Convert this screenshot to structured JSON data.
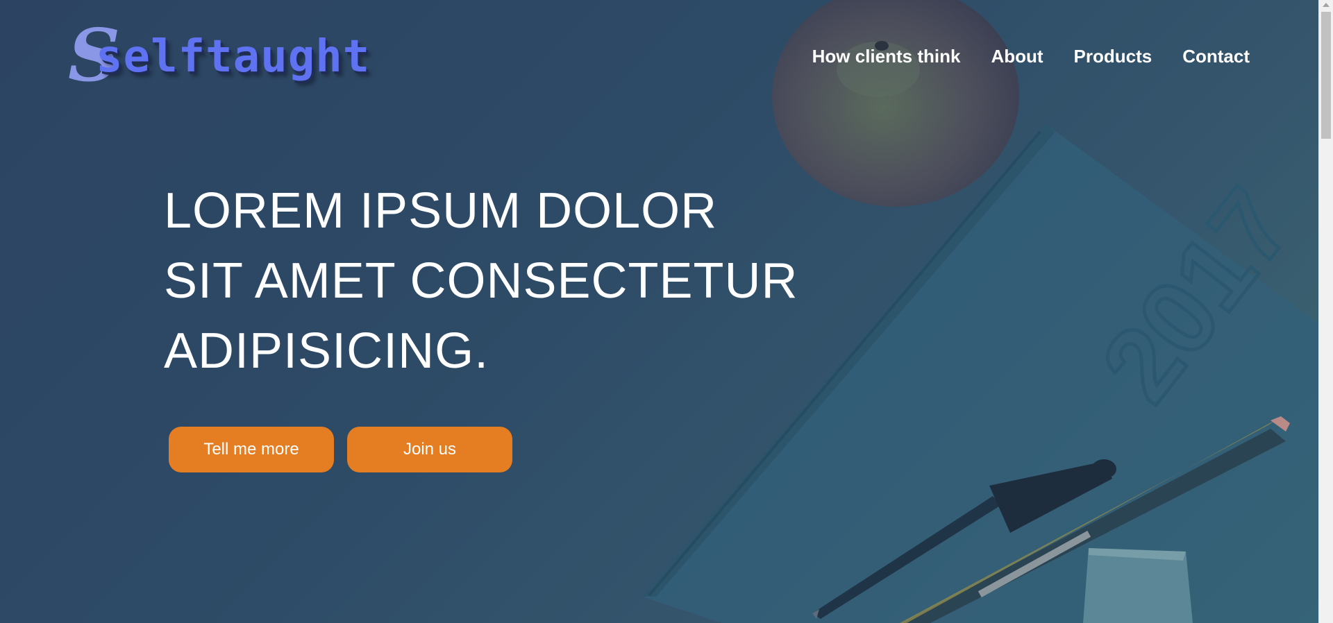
{
  "brand": {
    "logo_initial": "S",
    "logo_text": "selftaught",
    "logo_color": "#5f72f2"
  },
  "nav": {
    "items": [
      {
        "label": "How clients think"
      },
      {
        "label": "About"
      },
      {
        "label": "Products"
      },
      {
        "label": "Contact"
      }
    ]
  },
  "hero": {
    "heading_lines": [
      "LOREM IPSUM DOLOR",
      "SIT AMET CONSECTETUR",
      "ADIPISICING."
    ],
    "buttons": [
      {
        "label": "Tell me more"
      },
      {
        "label": "Join us"
      }
    ],
    "accent_color": "#e57e22",
    "background_color": "#2d4a66",
    "background_image_icons": [
      "apple-icon",
      "notebook-icon",
      "pen-icon",
      "pencil-icon",
      "eraser-icon"
    ],
    "notebook_cover_text": "2017"
  },
  "colors": {
    "text": "#ffffff",
    "scrollbar_track": "#f1f1f1",
    "scrollbar_thumb": "#c1c1c1"
  }
}
